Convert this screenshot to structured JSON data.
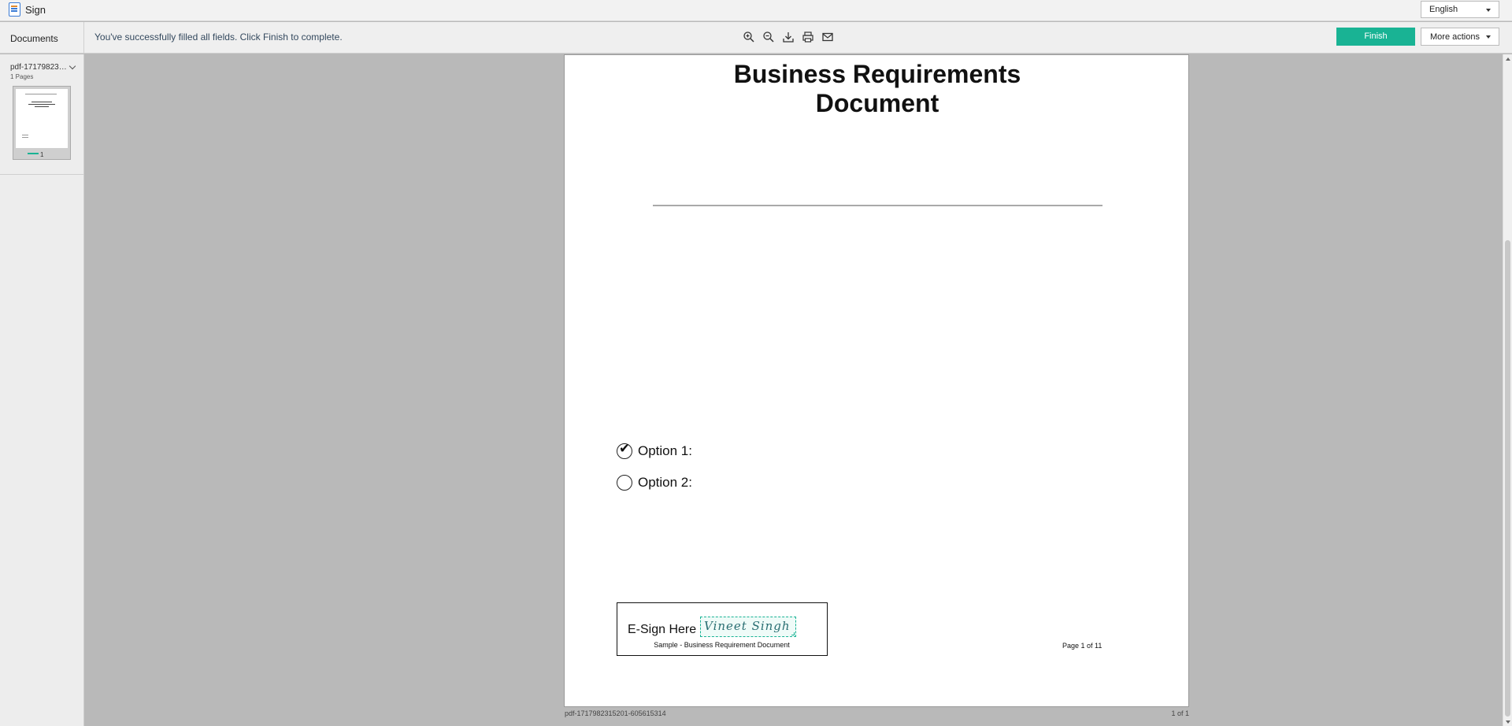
{
  "window": {
    "title": "Sign"
  },
  "language": {
    "selected": "English"
  },
  "toolbar": {
    "documents_label": "Documents",
    "status_message": "You've successfully filled all fields. Click Finish to complete.",
    "icons": [
      "zoom-in-icon",
      "zoom-out-icon",
      "download-icon",
      "print-icon",
      "email-icon"
    ],
    "finish_label": "Finish",
    "more_actions_label": "More actions",
    "accent_color": "#19b394"
  },
  "sidebar": {
    "document_name": "pdf-171798231…",
    "page_count": "1 Pages",
    "thumbnail_page": "1"
  },
  "document": {
    "title_line1": "Business Requirements",
    "title_line2": "Document",
    "options": [
      {
        "label": "Option 1:",
        "checked": true
      },
      {
        "label": "Option 2:",
        "checked": false
      }
    ],
    "esign_label": "E-Sign Here",
    "signature": "Vineet Singh",
    "sign_caption": "Sample - Business Requirement Document",
    "page_label": "Page 1 of 11"
  },
  "footer": {
    "file_name": "pdf-1717982315201-605615314",
    "page_count": "1 of 1"
  }
}
